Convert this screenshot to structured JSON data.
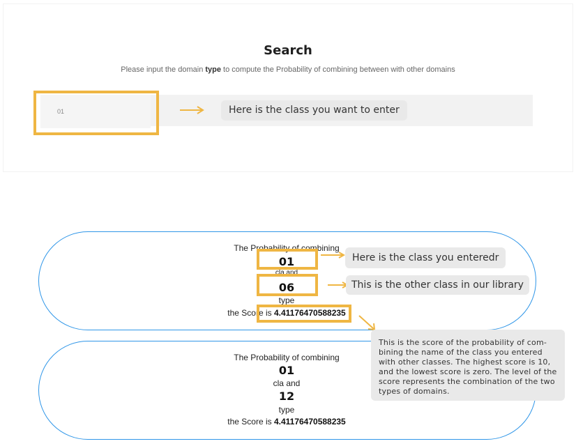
{
  "search": {
    "title": "Search",
    "subtitle_before": "Please input the domain ",
    "subtitle_bold": "type",
    "subtitle_after": " to compute the Probability of combining between with other domains",
    "input_value": "01",
    "annotation": "Here is the class you want to enter"
  },
  "results": [
    {
      "heading": "The Probability of combining",
      "class_a": "01",
      "connector": "cla and",
      "class_b": "06",
      "type_label": "type",
      "score_label": "the Score is ",
      "score_value": "4.41176470588235"
    },
    {
      "heading": "The Probability of combining",
      "class_a": "01",
      "connector": "cla and",
      "class_b": "12",
      "type_label": "type",
      "score_label": "the Score is ",
      "score_value": "4.41176470588235"
    }
  ],
  "annotations": {
    "entered_class": "Here is the class you enteredr",
    "other_class": "This is the other class in our library",
    "score_note": "This is the score of the probability of com- bining the name of the class you entered with other classes. The highest score is 10, and the lowest score is zero. The level of the score represents the combination of the two types of domains."
  },
  "colors": {
    "highlight": "#efb643",
    "pill_border": "#2f96e8",
    "note_bg": "#e9e9e9"
  }
}
